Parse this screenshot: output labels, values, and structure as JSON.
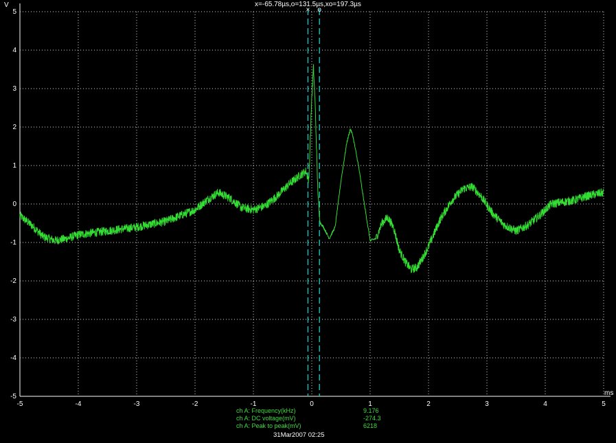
{
  "cursor_readout": "x=-65.78µs,o=131.5µs,xo=197.3µs",
  "cursors": {
    "x": {
      "label": "×",
      "time_us": -65.78
    },
    "o": {
      "label": "o",
      "time_us": 131.5
    }
  },
  "measurements": [
    {
      "label": "ch A: Frequency(kHz)",
      "value": "9.176"
    },
    {
      "label": "ch A: DC voltage(mV)",
      "value": "-274.3"
    },
    {
      "label": "ch A: Peak to peak(mV)",
      "value": "6218"
    }
  ],
  "timestamp": "31Mar2007  02:25",
  "colors": {
    "trace": "#33dd33",
    "cursor": "#1fb3b0",
    "grid": "#ffffff",
    "background": "#000000"
  },
  "chart_data": {
    "type": "line",
    "xlabel": "ms",
    "ylabel": "V",
    "xlim": [
      -5,
      5
    ],
    "ylim": [
      -5,
      5
    ],
    "xticks": [
      "-5",
      "-4",
      "-3",
      "-2",
      "-1",
      "0",
      "1",
      "2",
      "3",
      "4",
      "5"
    ],
    "yticks": [
      "5",
      "4",
      "3",
      "2",
      "1",
      "0",
      "-1",
      "-2",
      "-3",
      "-4",
      "-5"
    ],
    "grid": true,
    "series": [
      {
        "color": "#33dd33",
        "x": [
          -5,
          -4.8,
          -4.6,
          -4.4,
          -4.2,
          -4.0,
          -3.5,
          -3.0,
          -2.5,
          -2.0,
          -1.8,
          -1.6,
          -1.4,
          -1.2,
          -1.0,
          -0.8,
          -0.6,
          -0.4,
          -0.2,
          -0.1,
          -0.05,
          0.0,
          0.03,
          0.06,
          0.1,
          0.13,
          0.15,
          0.2,
          0.3,
          0.4,
          0.5,
          0.6,
          0.66,
          0.7,
          0.8,
          0.9,
          1.0,
          1.1,
          1.2,
          1.3,
          1.4,
          1.5,
          1.6,
          1.7,
          1.8,
          1.9,
          2.0,
          2.2,
          2.4,
          2.6,
          2.75,
          2.9,
          3.1,
          3.3,
          3.5,
          3.7,
          3.9,
          4.1,
          4.3,
          4.5,
          4.7,
          5.0
        ],
        "y": [
          -0.3,
          -0.55,
          -0.85,
          -0.95,
          -0.9,
          -0.8,
          -0.7,
          -0.6,
          -0.45,
          -0.15,
          0.1,
          0.3,
          0.15,
          -0.1,
          -0.15,
          -0.05,
          0.2,
          0.5,
          0.75,
          0.85,
          0.6,
          2.8,
          3.55,
          2.5,
          0.5,
          -0.35,
          -0.5,
          -0.6,
          -0.9,
          -0.6,
          0.6,
          1.6,
          1.95,
          1.8,
          1.0,
          0.0,
          -0.95,
          -0.9,
          -0.5,
          -0.35,
          -0.6,
          -1.2,
          -1.5,
          -1.7,
          -1.65,
          -1.4,
          -1.1,
          -0.4,
          0.1,
          0.4,
          0.45,
          0.2,
          -0.25,
          -0.55,
          -0.7,
          -0.55,
          -0.3,
          0.0,
          0.05,
          0.1,
          0.2,
          0.3
        ]
      }
    ]
  }
}
